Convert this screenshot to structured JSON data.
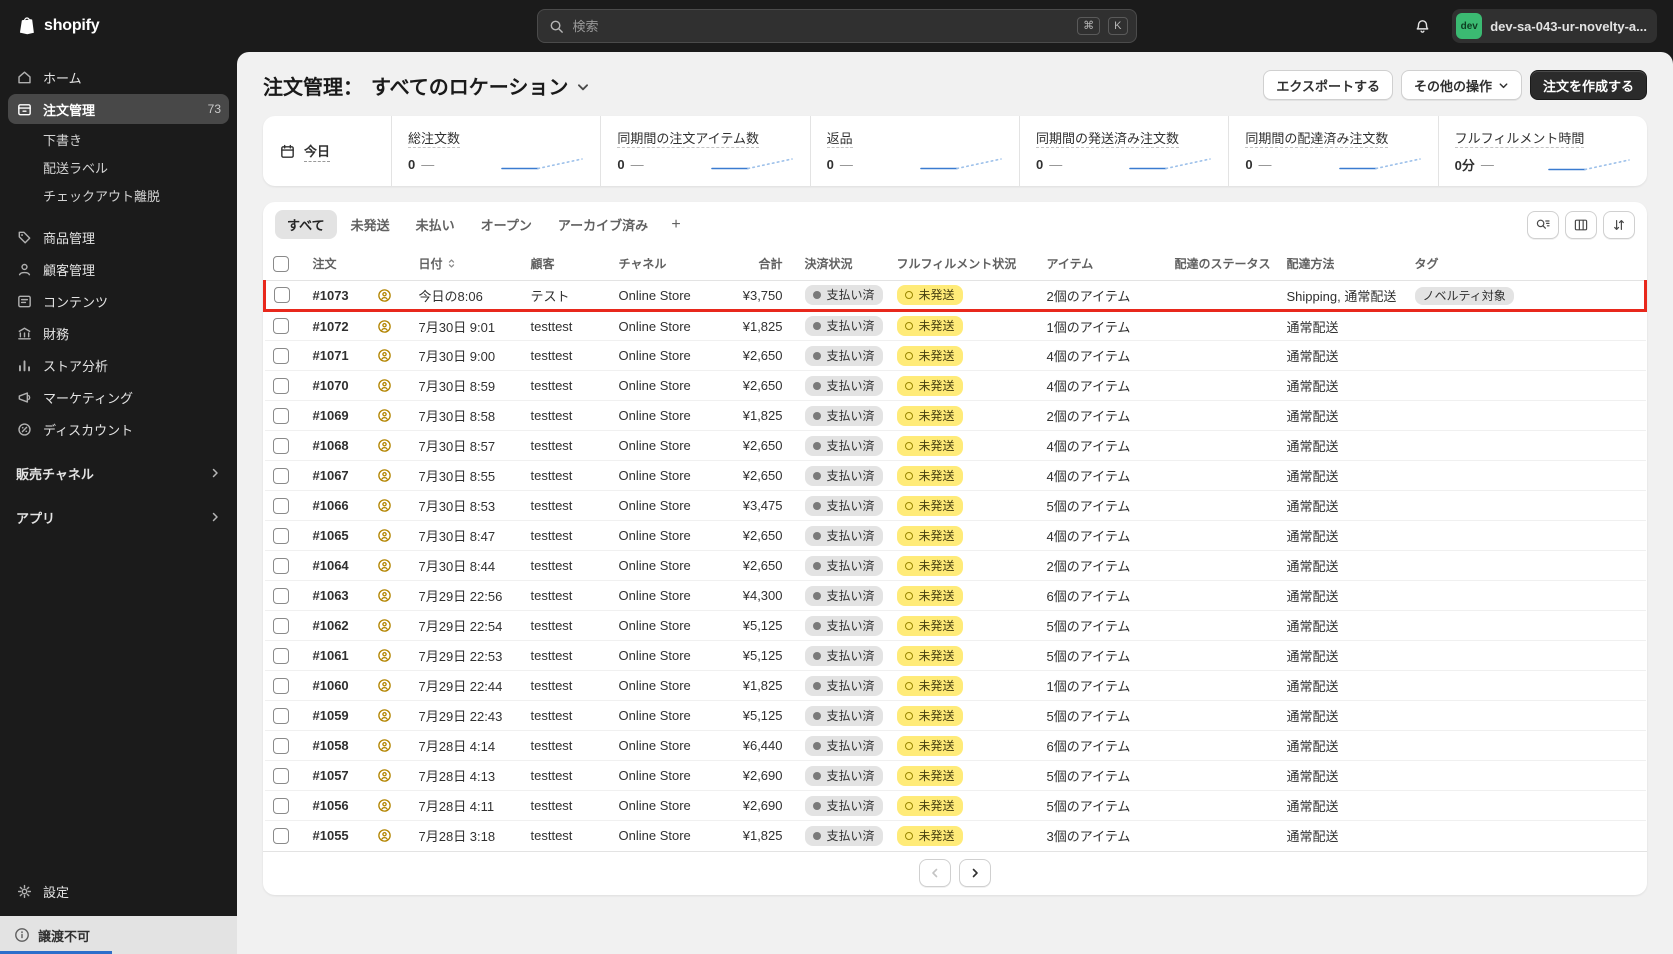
{
  "topbar": {
    "brand": "shopify",
    "search_placeholder": "検索",
    "key_cmd": "⌘",
    "key_k": "K",
    "store_badge": "dev",
    "store_name": "dev-sa-043-ur-novelty-a..."
  },
  "sidebar": {
    "items": [
      {
        "label": "ホーム"
      },
      {
        "label": "注文管理",
        "badge": "73"
      },
      {
        "label": "下書き"
      },
      {
        "label": "配送ラベル"
      },
      {
        "label": "チェックアウト離脱"
      },
      {
        "label": "商品管理"
      },
      {
        "label": "顧客管理"
      },
      {
        "label": "コンテンツ"
      },
      {
        "label": "財務"
      },
      {
        "label": "ストア分析"
      },
      {
        "label": "マーケティング"
      },
      {
        "label": "ディスカウント"
      }
    ],
    "sales_channels": "販売チャネル",
    "apps": "アプリ",
    "settings": "設定",
    "footer_banner": "譲渡不可"
  },
  "page": {
    "title": "注文管理：",
    "location": "すべてのロケーション",
    "export_button": "エクスポートする",
    "more_actions_button": "その他の操作",
    "create_order_button": "注文を作成する"
  },
  "metrics": {
    "period": "今日",
    "dash": "—",
    "items": [
      {
        "label": "総注文数",
        "value": "0"
      },
      {
        "label": "同期間の注文アイテム数",
        "value": "0"
      },
      {
        "label": "返品",
        "value": "0"
      },
      {
        "label": "同期間の発送済み注文数",
        "value": "0"
      },
      {
        "label": "同期間の配達済み注文数",
        "value": "0"
      },
      {
        "label": "フルフィルメント時間",
        "value": "0分"
      }
    ]
  },
  "tabs": {
    "items": [
      "すべて",
      "未発送",
      "未払い",
      "オープン",
      "アーカイブ済み"
    ],
    "active": "すべて"
  },
  "table": {
    "columns": {
      "order": "注文",
      "date": "日付",
      "customer": "顧客",
      "channel": "チャネル",
      "total": "合計",
      "payment": "決済状況",
      "fulfillment": "フルフィルメント状況",
      "items": "アイテム",
      "delivery_status": "配達のステータス",
      "shipping": "配達方法",
      "tags": "タグ"
    },
    "rows": [
      {
        "id": "#1073",
        "date": "今日の8:06",
        "customer": "テスト",
        "channel": "Online Store",
        "total": "¥3,750",
        "payment": "支払い済",
        "fulfillment": "未発送",
        "items": "2個のアイテム",
        "delivery_status": "",
        "shipping": "Shipping, 通常配送",
        "tags": [
          "ノベルティ対象"
        ],
        "highlighted": true
      },
      {
        "id": "#1072",
        "date": "7月30日 9:01",
        "customer": "testtest",
        "channel": "Online Store",
        "total": "¥1,825",
        "payment": "支払い済",
        "fulfillment": "未発送",
        "items": "1個のアイテム",
        "delivery_status": "",
        "shipping": "通常配送",
        "tags": []
      },
      {
        "id": "#1071",
        "date": "7月30日 9:00",
        "customer": "testtest",
        "channel": "Online Store",
        "total": "¥2,650",
        "payment": "支払い済",
        "fulfillment": "未発送",
        "items": "4個のアイテム",
        "delivery_status": "",
        "shipping": "通常配送",
        "tags": []
      },
      {
        "id": "#1070",
        "date": "7月30日 8:59",
        "customer": "testtest",
        "channel": "Online Store",
        "total": "¥2,650",
        "payment": "支払い済",
        "fulfillment": "未発送",
        "items": "4個のアイテム",
        "delivery_status": "",
        "shipping": "通常配送",
        "tags": []
      },
      {
        "id": "#1069",
        "date": "7月30日 8:58",
        "customer": "testtest",
        "channel": "Online Store",
        "total": "¥1,825",
        "payment": "支払い済",
        "fulfillment": "未発送",
        "items": "2個のアイテム",
        "delivery_status": "",
        "shipping": "通常配送",
        "tags": []
      },
      {
        "id": "#1068",
        "date": "7月30日 8:57",
        "customer": "testtest",
        "channel": "Online Store",
        "total": "¥2,650",
        "payment": "支払い済",
        "fulfillment": "未発送",
        "items": "4個のアイテム",
        "delivery_status": "",
        "shipping": "通常配送",
        "tags": []
      },
      {
        "id": "#1067",
        "date": "7月30日 8:55",
        "customer": "testtest",
        "channel": "Online Store",
        "total": "¥2,650",
        "payment": "支払い済",
        "fulfillment": "未発送",
        "items": "4個のアイテム",
        "delivery_status": "",
        "shipping": "通常配送",
        "tags": []
      },
      {
        "id": "#1066",
        "date": "7月30日 8:53",
        "customer": "testtest",
        "channel": "Online Store",
        "total": "¥3,475",
        "payment": "支払い済",
        "fulfillment": "未発送",
        "items": "5個のアイテム",
        "delivery_status": "",
        "shipping": "通常配送",
        "tags": []
      },
      {
        "id": "#1065",
        "date": "7月30日 8:47",
        "customer": "testtest",
        "channel": "Online Store",
        "total": "¥2,650",
        "payment": "支払い済",
        "fulfillment": "未発送",
        "items": "4個のアイテム",
        "delivery_status": "",
        "shipping": "通常配送",
        "tags": []
      },
      {
        "id": "#1064",
        "date": "7月30日 8:44",
        "customer": "testtest",
        "channel": "Online Store",
        "total": "¥2,650",
        "payment": "支払い済",
        "fulfillment": "未発送",
        "items": "2個のアイテム",
        "delivery_status": "",
        "shipping": "通常配送",
        "tags": []
      },
      {
        "id": "#1063",
        "date": "7月29日 22:56",
        "customer": "testtest",
        "channel": "Online Store",
        "total": "¥4,300",
        "payment": "支払い済",
        "fulfillment": "未発送",
        "items": "6個のアイテム",
        "delivery_status": "",
        "shipping": "通常配送",
        "tags": []
      },
      {
        "id": "#1062",
        "date": "7月29日 22:54",
        "customer": "testtest",
        "channel": "Online Store",
        "total": "¥5,125",
        "payment": "支払い済",
        "fulfillment": "未発送",
        "items": "5個のアイテム",
        "delivery_status": "",
        "shipping": "通常配送",
        "tags": []
      },
      {
        "id": "#1061",
        "date": "7月29日 22:53",
        "customer": "testtest",
        "channel": "Online Store",
        "total": "¥5,125",
        "payment": "支払い済",
        "fulfillment": "未発送",
        "items": "5個のアイテム",
        "delivery_status": "",
        "shipping": "通常配送",
        "tags": []
      },
      {
        "id": "#1060",
        "date": "7月29日 22:44",
        "customer": "testtest",
        "channel": "Online Store",
        "total": "¥1,825",
        "payment": "支払い済",
        "fulfillment": "未発送",
        "items": "1個のアイテム",
        "delivery_status": "",
        "shipping": "通常配送",
        "tags": []
      },
      {
        "id": "#1059",
        "date": "7月29日 22:43",
        "customer": "testtest",
        "channel": "Online Store",
        "total": "¥5,125",
        "payment": "支払い済",
        "fulfillment": "未発送",
        "items": "5個のアイテム",
        "delivery_status": "",
        "shipping": "通常配送",
        "tags": []
      },
      {
        "id": "#1058",
        "date": "7月28日 4:14",
        "customer": "testtest",
        "channel": "Online Store",
        "total": "¥6,440",
        "payment": "支払い済",
        "fulfillment": "未発送",
        "items": "6個のアイテム",
        "delivery_status": "",
        "shipping": "通常配送",
        "tags": []
      },
      {
        "id": "#1057",
        "date": "7月28日 4:13",
        "customer": "testtest",
        "channel": "Online Store",
        "total": "¥2,690",
        "payment": "支払い済",
        "fulfillment": "未発送",
        "items": "5個のアイテム",
        "delivery_status": "",
        "shipping": "通常配送",
        "tags": []
      },
      {
        "id": "#1056",
        "date": "7月28日 4:11",
        "customer": "testtest",
        "channel": "Online Store",
        "total": "¥2,690",
        "payment": "支払い済",
        "fulfillment": "未発送",
        "items": "5個のアイテム",
        "delivery_status": "",
        "shipping": "通常配送",
        "tags": []
      },
      {
        "id": "#1055",
        "date": "7月28日 3:18",
        "customer": "testtest",
        "channel": "Online Store",
        "total": "¥1,825",
        "payment": "支払い済",
        "fulfillment": "未発送",
        "items": "3個のアイテム",
        "delivery_status": "",
        "shipping": "通常配送",
        "tags": []
      }
    ]
  },
  "colors": {
    "accent_blue": "#2e72d2",
    "badge_yellow": "#ffeb78",
    "highlight_red": "#e8281c",
    "avatar_green": "#3bba72"
  }
}
